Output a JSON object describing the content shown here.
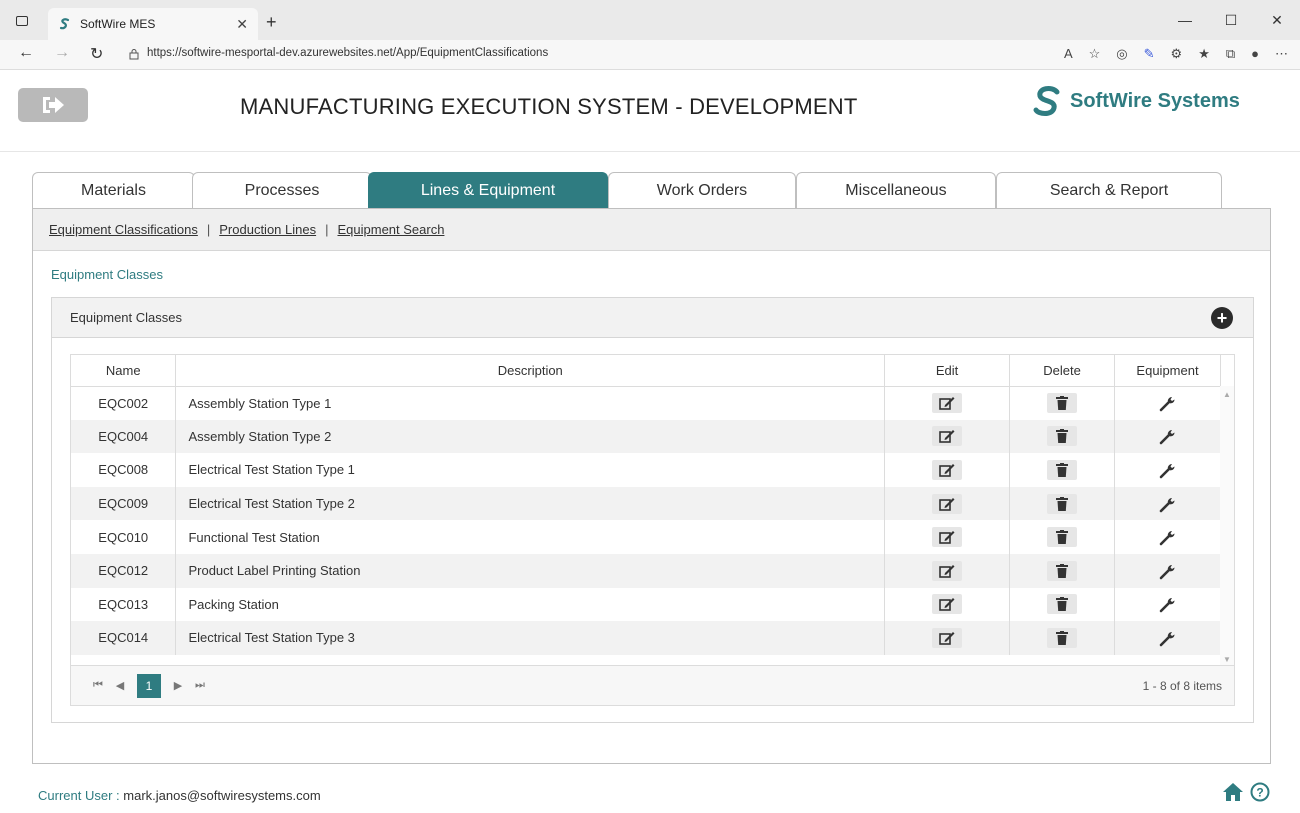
{
  "browser": {
    "tab_title": "SoftWire MES",
    "url": "https://softwire-mesportal-dev.azurewebsites.net/App/EquipmentClassifications"
  },
  "header": {
    "title": "MANUFACTURING EXECUTION SYSTEM - DEVELOPMENT",
    "brand": "SoftWire Systems",
    "accent_color": "#2f7c81"
  },
  "main_tabs": [
    {
      "label": "Materials"
    },
    {
      "label": "Processes"
    },
    {
      "label": "Lines & Equipment",
      "active": true
    },
    {
      "label": "Work Orders"
    },
    {
      "label": "Miscellaneous"
    },
    {
      "label": "Search & Report"
    }
  ],
  "subnav": [
    {
      "label": "Equipment Classifications"
    },
    {
      "label": "Production Lines"
    },
    {
      "label": "Equipment Search"
    }
  ],
  "breadcrumb": "Equipment Classes",
  "card": {
    "title": "Equipment Classes",
    "add_icon": "plus-circle-icon"
  },
  "table": {
    "columns": [
      "Name",
      "Description",
      "Edit",
      "Delete",
      "Equipment"
    ],
    "rows": [
      {
        "name": "EQC002",
        "description": "Assembly Station Type 1"
      },
      {
        "name": "EQC004",
        "description": "Assembly Station Type 2"
      },
      {
        "name": "EQC008",
        "description": "Electrical Test Station Type 1"
      },
      {
        "name": "EQC009",
        "description": "Electrical Test Station Type 2"
      },
      {
        "name": "EQC010",
        "description": "Functional Test Station"
      },
      {
        "name": "EQC012",
        "description": "Product Label Printing Station"
      },
      {
        "name": "EQC013",
        "description": "Packing Station"
      },
      {
        "name": "EQC014",
        "description": "Electrical Test Station Type 3"
      }
    ]
  },
  "pager": {
    "current_page": "1",
    "info": "1 - 8 of 8 items"
  },
  "footer": {
    "user_label": "Current User :",
    "user_value": "mark.janos@softwiresystems.com"
  }
}
